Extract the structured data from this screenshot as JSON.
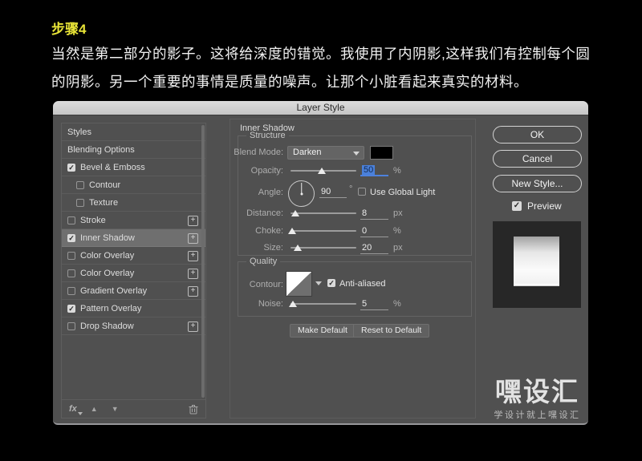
{
  "page": {
    "step_title": "步骤4",
    "body_line1": "当然是第二部分的影子。这将给深度的错觉。我使用了内阴影,这样我们有控制每个圆",
    "body_line2": "的阴影。另一个重要的事情是质量的噪声。让那个小脏看起来真实的材料。"
  },
  "dialog": {
    "title": "Layer Style",
    "sidebar": {
      "items": [
        {
          "label": "Styles"
        },
        {
          "label": "Blending Options"
        },
        {
          "label": "Bevel & Emboss",
          "checked": true
        },
        {
          "label": "Contour",
          "checked": false,
          "indent": true
        },
        {
          "label": "Texture",
          "checked": false,
          "indent": true
        },
        {
          "label": "Stroke",
          "checked": false,
          "plus": true
        },
        {
          "label": "Inner Shadow",
          "checked": true,
          "plus": true,
          "selected": true
        },
        {
          "label": "Color Overlay",
          "checked": false,
          "plus": true
        },
        {
          "label": "Color Overlay",
          "checked": false,
          "plus": true
        },
        {
          "label": "Gradient Overlay",
          "checked": false,
          "plus": true
        },
        {
          "label": "Pattern Overlay",
          "checked": true
        },
        {
          "label": "Drop Shadow",
          "checked": false,
          "plus": true
        }
      ]
    },
    "main": {
      "effect_title": "Inner Shadow",
      "structure": {
        "legend": "Structure",
        "blend_mode_label": "Blend Mode:",
        "blend_mode_value": "Darken",
        "opacity_label": "Opacity:",
        "opacity_value": "50",
        "opacity_unit": "%",
        "angle_label": "Angle:",
        "angle_value": "90",
        "angle_unit": "°",
        "use_global_light_label": "Use Global Light",
        "use_global_light_checked": false,
        "distance_label": "Distance:",
        "distance_value": "8",
        "distance_unit": "px",
        "choke_label": "Choke:",
        "choke_value": "0",
        "choke_unit": "%",
        "size_label": "Size:",
        "size_value": "20",
        "size_unit": "px"
      },
      "quality": {
        "legend": "Quality",
        "contour_label": "Contour:",
        "anti_aliased_label": "Anti-aliased",
        "anti_aliased_checked": true,
        "noise_label": "Noise:",
        "noise_value": "5",
        "noise_unit": "%"
      },
      "make_default_label": "Make Default",
      "reset_default_label": "Reset to Default"
    },
    "actions": {
      "ok": "OK",
      "cancel": "Cancel",
      "new_style": "New Style...",
      "preview_label": "Preview",
      "preview_checked": true
    }
  },
  "watermark": {
    "logo": "嘿设汇",
    "tagline": "学设计就上嘿设汇"
  },
  "icons": {
    "check": "✓",
    "plus": "+",
    "fx": "fx",
    "up_arrow": "▲",
    "down_arrow": "▼"
  },
  "colors": {
    "step_title": "#e8e437",
    "dialog_bg": "#505050",
    "selection_blue": "#4a80d9",
    "selected_row": "#6f6f6f"
  }
}
